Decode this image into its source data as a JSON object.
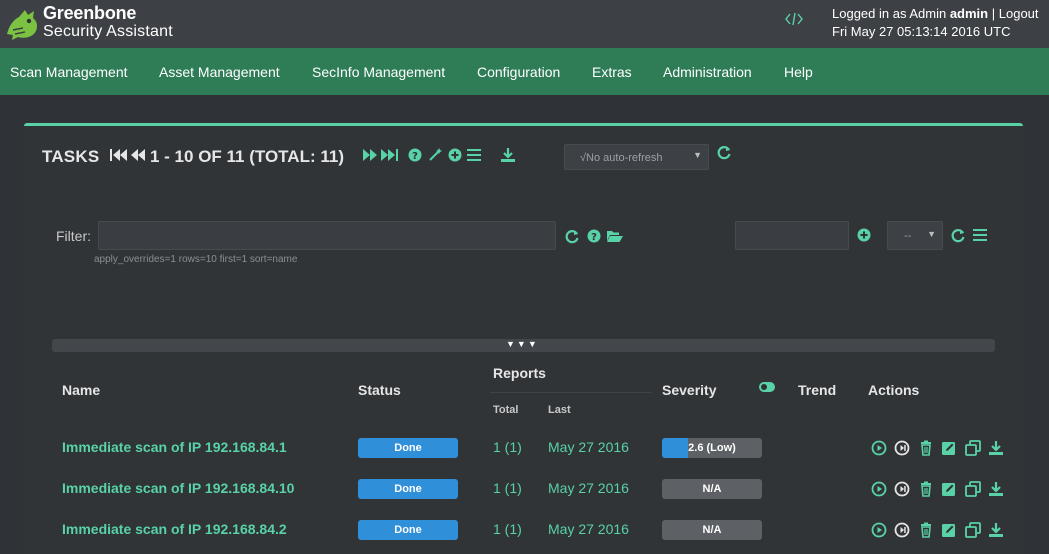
{
  "header": {
    "brand_line1": "Greenbone",
    "brand_line2": "Security Assistant",
    "login_prefix": "Logged in as Admin",
    "username": "admin",
    "separator": "|",
    "logout": "Logout",
    "datetime": "Fri May 27 05:13:14 2016 UTC"
  },
  "nav": {
    "items": [
      {
        "label": "Scan Management"
      },
      {
        "label": "Asset Management"
      },
      {
        "label": "SecInfo Management"
      },
      {
        "label": "Configuration"
      },
      {
        "label": "Extras"
      },
      {
        "label": "Administration"
      },
      {
        "label": "Help"
      }
    ]
  },
  "tasks": {
    "title": "TASKS",
    "pager": "1 - 10 OF 11 (TOTAL: 11)",
    "refresh_select": "√No auto-refresh"
  },
  "filter": {
    "label": "Filter:",
    "value": "",
    "hint": "apply_overrides=1 rows=10 first=1 sort=name",
    "saved_filter_select": "--"
  },
  "table": {
    "headers": {
      "name": "Name",
      "status": "Status",
      "reports": "Reports",
      "total": "Total",
      "last": "Last",
      "severity": "Severity",
      "trend": "Trend",
      "actions": "Actions"
    },
    "rows": [
      {
        "name": "Immediate scan of IP 192.168.84.1",
        "status": "Done",
        "total_a": "1",
        "total_b": "1",
        "last": "May 27 2016",
        "severity_label": "2.6 (Low)",
        "severity_value": 2.6
      },
      {
        "name": "Immediate scan of IP 192.168.84.10",
        "status": "Done",
        "total_a": "1",
        "total_b": "1",
        "last": "May 27 2016",
        "severity_label": "N/A",
        "severity_value": 0
      },
      {
        "name": "Immediate scan of IP 192.168.84.2",
        "status": "Done",
        "total_a": "1",
        "total_b": "1",
        "last": "May 27 2016",
        "severity_label": "N/A",
        "severity_value": 0
      }
    ]
  },
  "colors": {
    "accent": "#58d2a6",
    "nav_bg": "#2e7d57",
    "status_blue": "#2f8fd8"
  }
}
